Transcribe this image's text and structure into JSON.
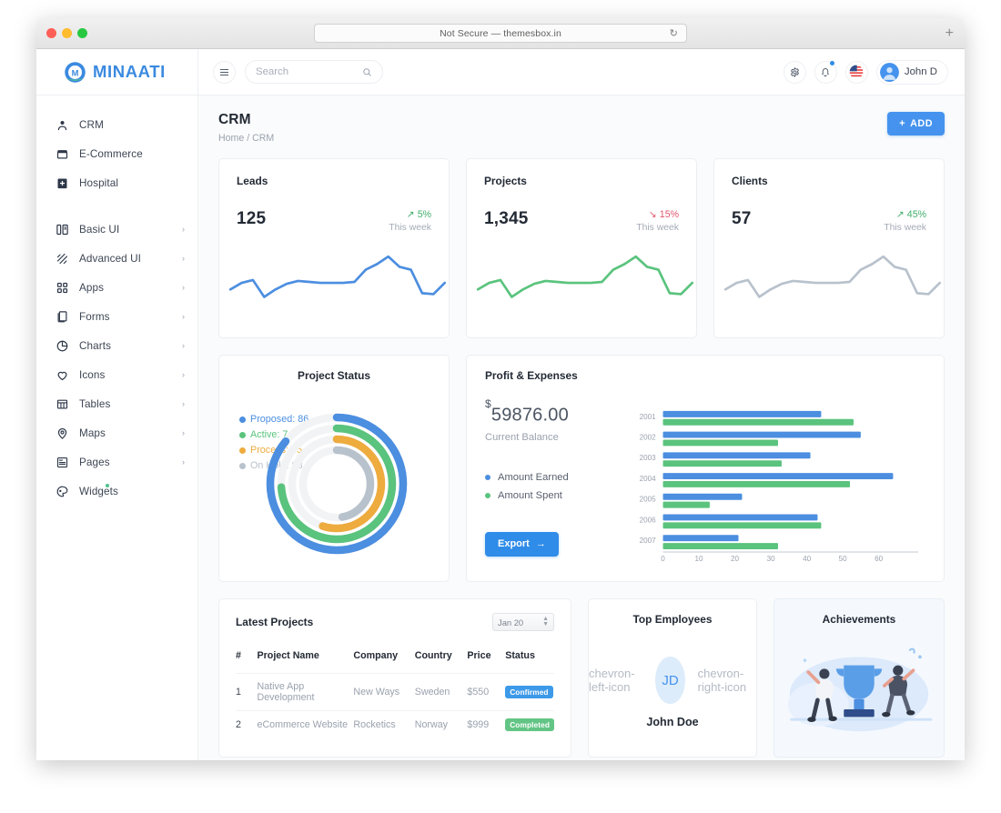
{
  "browser": {
    "url_text": "Not Secure — themesbox.in",
    "reload_icon": "reload-icon",
    "new_tab_icon": "plus-icon"
  },
  "brand": {
    "name": "MINAATI",
    "logo_icon": "minaati-logo"
  },
  "sidebar": {
    "items": [
      {
        "label": "CRM",
        "icon": "user-icon",
        "chevron": "",
        "badge": ""
      },
      {
        "label": "E-Commerce",
        "icon": "store-icon",
        "chevron": "",
        "badge": ""
      },
      {
        "label": "Hospital",
        "icon": "hospital-icon",
        "chevron": "",
        "badge": ""
      },
      {
        "label": "Basic UI",
        "icon": "layout-icon",
        "chevron": "›",
        "badge": ""
      },
      {
        "label": "Advanced UI",
        "icon": "sparkle-icon",
        "chevron": "›",
        "badge": ""
      },
      {
        "label": "Apps",
        "icon": "grid-icon",
        "chevron": "›",
        "badge": ""
      },
      {
        "label": "Forms",
        "icon": "form-icon",
        "chevron": "›",
        "badge": ""
      },
      {
        "label": "Charts",
        "icon": "pie-chart-icon",
        "chevron": "›",
        "badge": ""
      },
      {
        "label": "Icons",
        "icon": "heart-icon",
        "chevron": "›",
        "badge": ""
      },
      {
        "label": "Tables",
        "icon": "table-icon",
        "chevron": "›",
        "badge": ""
      },
      {
        "label": "Maps",
        "icon": "map-pin-icon",
        "chevron": "›",
        "badge": ""
      },
      {
        "label": "Pages",
        "icon": "page-icon",
        "chevron": "›",
        "badge": ""
      },
      {
        "label": "Widgets",
        "icon": "palette-icon",
        "chevron": "",
        "badge": "dot"
      }
    ]
  },
  "topbar": {
    "menu_icon": "hamburger-icon",
    "search": {
      "placeholder": "Search",
      "value": "",
      "icon": "search-icon"
    },
    "settings_icon": "gear-icon",
    "notification_icon": "bell-icon",
    "language_icon": "us-flag-icon",
    "user": {
      "name": "John D",
      "avatar_icon": "avatar-icon"
    }
  },
  "page": {
    "title": "CRM",
    "breadcrumb_home": "Home",
    "breadcrumb_sep": "/",
    "breadcrumb_current": "CRM",
    "add_button": "ADD",
    "add_icon": "plus-icon"
  },
  "stats": [
    {
      "title": "Leads",
      "value": "125",
      "pct": "5%",
      "dir": "up",
      "arrow": "↗",
      "period": "This week",
      "color": "#4c8ee0"
    },
    {
      "title": "Projects",
      "value": "1,345",
      "pct": "15%",
      "dir": "down",
      "arrow": "↘",
      "period": "This week",
      "color": "#5ac37d"
    },
    {
      "title": "Clients",
      "value": "57",
      "pct": "45%",
      "dir": "up",
      "arrow": "↗",
      "period": "This week",
      "color": "#b8c2cc"
    }
  ],
  "project_status": {
    "title": "Project Status",
    "legend": [
      {
        "label": "Proposed: 86",
        "color": "#4c8ee0"
      },
      {
        "label": "Active: 74",
        "color": "#5ac37d"
      },
      {
        "label": "Process: 55",
        "color": "#eeab3e"
      },
      {
        "label": "On Hold: 93",
        "color": "#b8c2cc"
      }
    ]
  },
  "profit": {
    "title": "Profit & Expenses",
    "currency": "$",
    "balance": "59876.00",
    "balance_label": "Current Balance",
    "legend": [
      {
        "label": "Amount Earned",
        "color": "#4c8ee0"
      },
      {
        "label": "Amount Spent",
        "color": "#5ac37d"
      }
    ],
    "export_label": "Export",
    "export_icon": "arrow-right-icon"
  },
  "latest_projects": {
    "title": "Latest Projects",
    "date_filter": "Jan 20",
    "columns": [
      "#",
      "Project Name",
      "Company",
      "Country",
      "Price",
      "Status"
    ],
    "rows": [
      {
        "idx": "1",
        "name": "Native App Development",
        "company": "New Ways",
        "country": "Sweden",
        "price": "$550",
        "status": "Confirmed",
        "status_kind": "confirmed"
      },
      {
        "idx": "2",
        "name": "eCommerce Website",
        "company": "Rocketics",
        "country": "Norway",
        "price": "$999",
        "status": "Completed",
        "status_kind": "completed"
      }
    ]
  },
  "top_employees": {
    "title": "Top Employees",
    "initials": "JD",
    "name": "John Doe",
    "prev_icon": "chevron-left-icon",
    "next_icon": "chevron-right-icon"
  },
  "achievements": {
    "title": "Achievements",
    "art_icon": "trophy-celebration-illustration"
  },
  "chart_data": [
    {
      "type": "line",
      "title": "Leads sparkline",
      "series": [
        {
          "name": "Leads",
          "values": [
            30,
            42,
            36,
            18,
            30,
            40,
            45,
            44,
            42,
            43,
            43,
            44,
            62,
            70,
            84,
            72,
            68,
            34,
            32,
            48
          ],
          "color": "#4c8ee0"
        }
      ],
      "grid": false,
      "legend": "none"
    },
    {
      "type": "line",
      "title": "Projects sparkline",
      "series": [
        {
          "name": "Projects",
          "values": [
            30,
            42,
            36,
            18,
            30,
            40,
            45,
            44,
            42,
            43,
            43,
            44,
            62,
            70,
            84,
            72,
            68,
            34,
            32,
            48
          ],
          "color": "#5ac37d"
        }
      ],
      "grid": false,
      "legend": "none"
    },
    {
      "type": "line",
      "title": "Clients sparkline",
      "series": [
        {
          "name": "Clients",
          "values": [
            30,
            42,
            36,
            18,
            30,
            40,
            45,
            44,
            42,
            43,
            43,
            44,
            62,
            70,
            84,
            72,
            68,
            34,
            32,
            48
          ],
          "color": "#b8c2cc"
        }
      ],
      "grid": false,
      "legend": "none"
    },
    {
      "type": "pie",
      "title": "Project Status",
      "subtype": "radial-bar",
      "categories": [
        "Proposed",
        "Active",
        "Process",
        "On Hold"
      ],
      "values": [
        86,
        74,
        55,
        93
      ],
      "colors": [
        "#4c8ee0",
        "#5ac37d",
        "#eeab3e",
        "#b8c2cc"
      ],
      "max": 100,
      "legend": "left"
    },
    {
      "type": "bar",
      "subtype": "horizontal-grouped",
      "title": "Profit & Expenses",
      "categories": [
        "2001",
        "2002",
        "2003",
        "2004",
        "2005",
        "2006",
        "2007"
      ],
      "series": [
        {
          "name": "Amount Earned",
          "color": "#4c8ee0",
          "values": [
            44,
            55,
            41,
            64,
            22,
            43,
            21
          ]
        },
        {
          "name": "Amount Spent",
          "color": "#5ac37d",
          "values": [
            53,
            32,
            33,
            52,
            13,
            44,
            32
          ]
        }
      ],
      "xlabel": "",
      "ylabel": "",
      "xticks": [
        0,
        10,
        20,
        30,
        40,
        50,
        60
      ],
      "xlim": [
        0,
        70
      ],
      "grid": false,
      "legend": "left"
    }
  ]
}
